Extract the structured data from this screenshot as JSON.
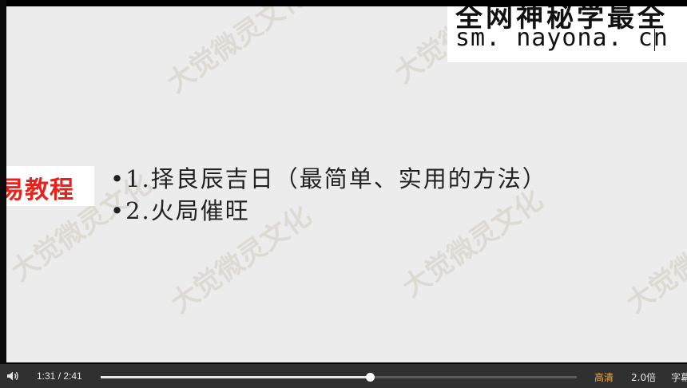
{
  "player": {
    "slide": {
      "watermark_text": "大觉微灵文化",
      "top_card": {
        "line1": "全网神秘学最全",
        "line2": "sm. nayona. cn"
      },
      "left_tag": "易教程",
      "bullets": [
        "•1.择良辰吉日（最简单、实用的方法）",
        "•2.火局催旺"
      ]
    },
    "controls": {
      "time": "1:31 / 2:41",
      "progress_fraction": 0.5652,
      "quality": "高清",
      "speed": "2.0倍",
      "subtitles": "字幕"
    },
    "colors": {
      "tag_red": "#e8231b",
      "quality_orange": "#f2a940",
      "control_bar": "#303030"
    },
    "icons": {
      "volume": "volume-icon"
    }
  }
}
